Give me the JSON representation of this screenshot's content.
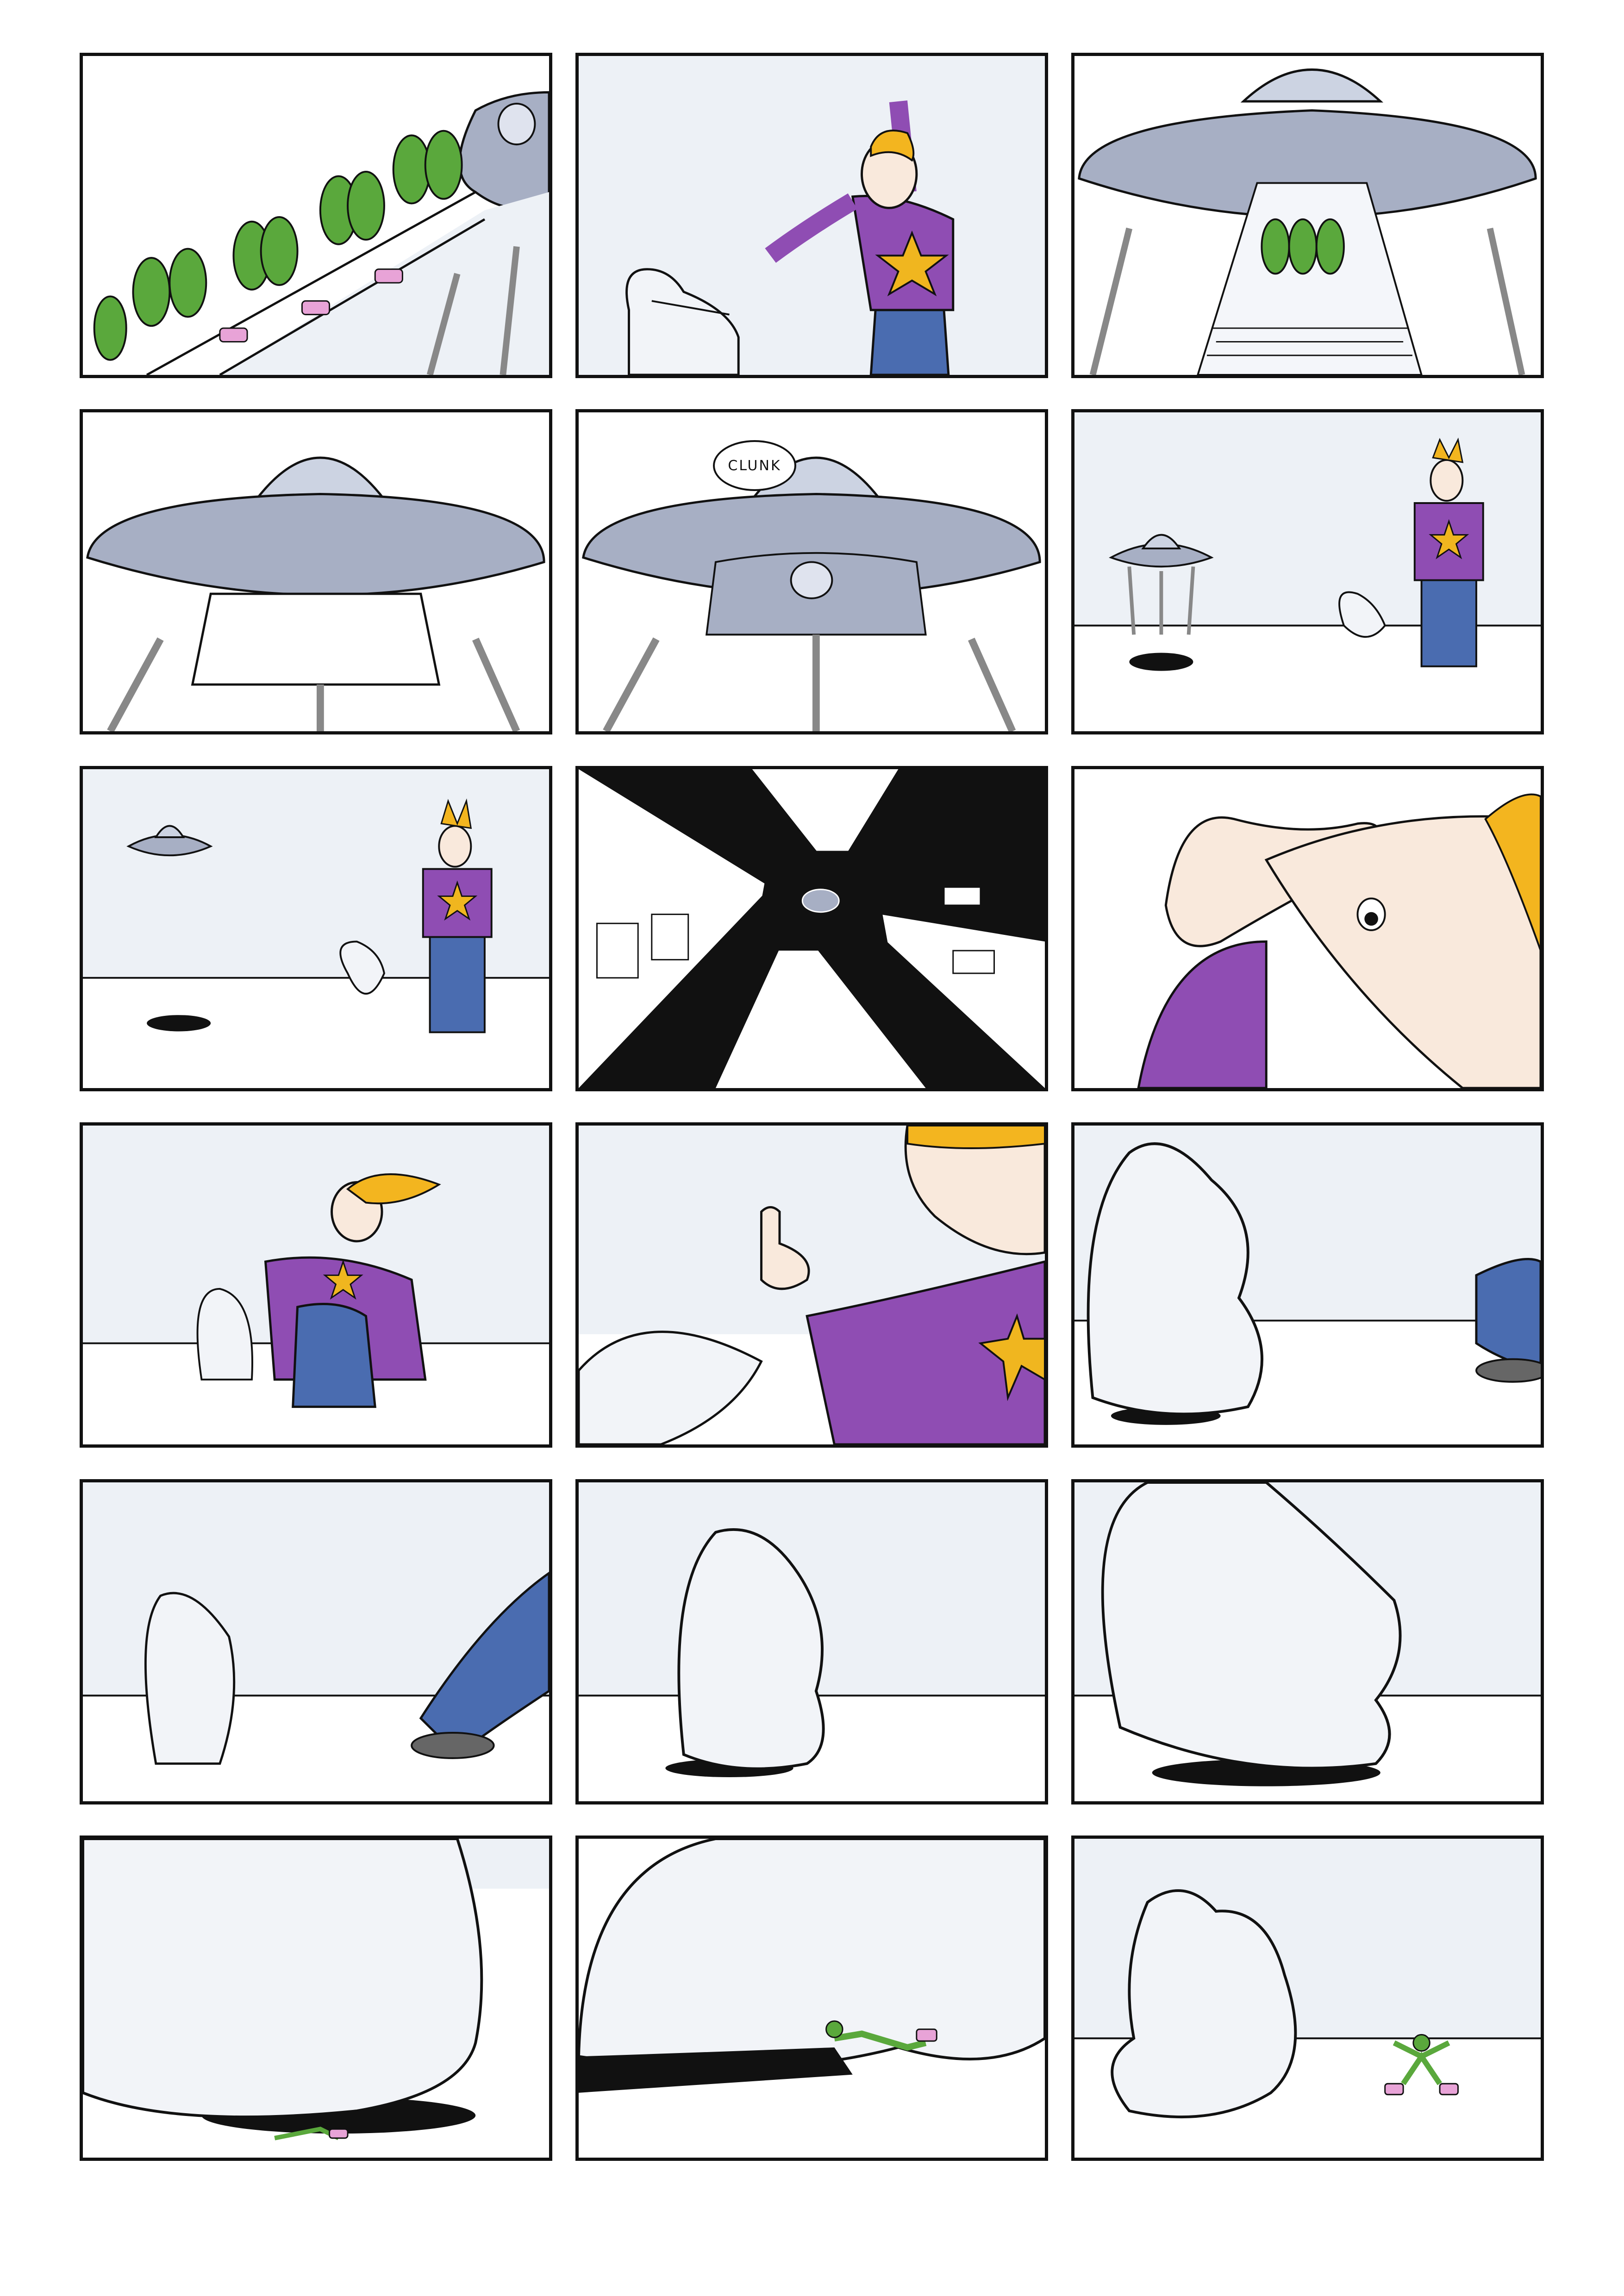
{
  "speech_balloon": {
    "text": "CLUNK"
  },
  "colors": {
    "sky": "#edf1f6",
    "ground": "#ffffff",
    "ufo": "#a7afc4",
    "ufo_dark": "#8e96ad",
    "dome": "#ccd3e2",
    "beam": "#ffffff",
    "alien": "#5aa83c",
    "alien_boots": "#e8a3d7",
    "sweater": "#8f4db3",
    "star": "#f0b61f",
    "jeans": "#4a6cb0",
    "hair": "#f3b51f",
    "skin": "#f9e9dc",
    "creature": "#f2f4f8",
    "ink": "#111111"
  },
  "icons": [
    "music-note-icon"
  ]
}
